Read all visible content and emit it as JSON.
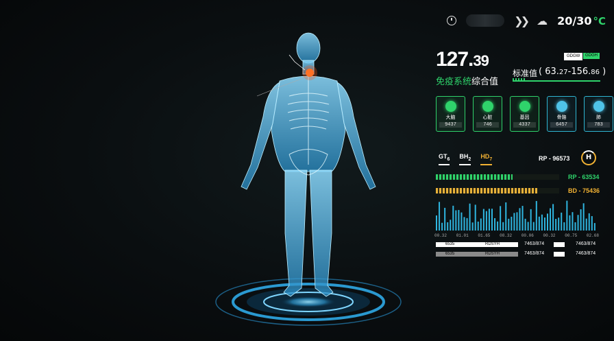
{
  "header": {
    "temperature": "20/30",
    "temp_unit": "°C",
    "icons": [
      "timer-icon",
      "double-chevron-icon",
      "weather-icon"
    ]
  },
  "score": {
    "integer": "127.",
    "decimal": "39",
    "label_green": "免疫系统",
    "label_white": "综合值",
    "tags": [
      "GDGW",
      "GDGH"
    ],
    "standard_label": "标准值",
    "range_open": "(",
    "range_low": "63.",
    "range_low_small": "27",
    "range_dash": "-156.",
    "range_high_small": "86",
    "range_close": ")"
  },
  "organs": [
    {
      "name": "大脑",
      "value": "9437",
      "icon": "brain-icon"
    },
    {
      "name": "心脏",
      "value": "746",
      "icon": "heart-icon"
    },
    {
      "name": "基因",
      "value": "4337",
      "icon": "gene-icon"
    },
    {
      "name": "骨骼",
      "value": "6457",
      "icon": "bone-icon"
    },
    {
      "name": "肺",
      "value": "783",
      "icon": "lung-icon"
    }
  ],
  "chips": [
    {
      "main": "GT",
      "sub": "6"
    },
    {
      "main": "BH",
      "sub": "2"
    },
    {
      "main": "HD",
      "sub": "7"
    }
  ],
  "rp_main": "RP - 96573",
  "h_badge": "H",
  "bars": [
    {
      "label": "RP - 63534",
      "fill": 0.62,
      "color": "#2fd36b"
    },
    {
      "label": "BD - 75436",
      "fill": 0.82,
      "color": "#f2b233"
    }
  ],
  "wave_ticks": [
    "00.32",
    "01.01",
    "01.65",
    "08.32",
    "00.06",
    "00.32",
    "00.75",
    "02.68"
  ],
  "rows": [
    {
      "left": "6535",
      "mid": "RDSYH",
      "v1": "7463/874",
      "v2": "7463/874",
      "style": "white"
    },
    {
      "left": "6535",
      "mid": "RDSYH",
      "v1": "7463/874",
      "v2": "7463/874",
      "style": "gray"
    }
  ],
  "colors": {
    "accent_green": "#2fd36b",
    "accent_yellow": "#f2b233",
    "hologram_blue": "#4fc3e8"
  }
}
